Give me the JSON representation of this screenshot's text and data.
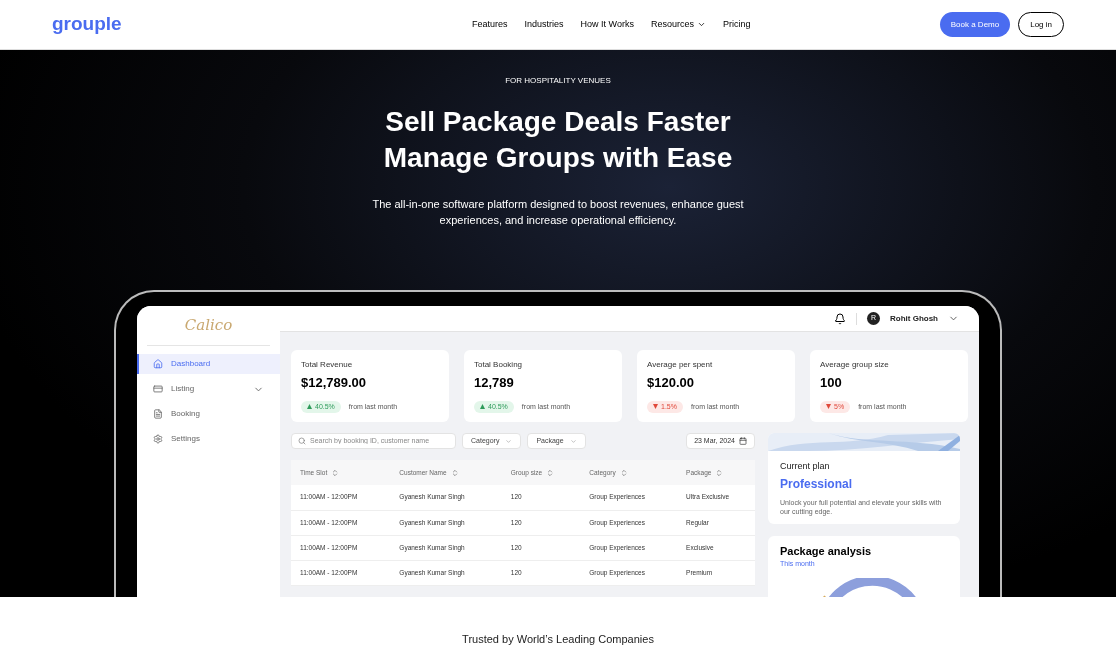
{
  "nav": {
    "logo": "grouple",
    "links": [
      {
        "label": "Features",
        "dropdown": false
      },
      {
        "label": "Industries",
        "dropdown": false
      },
      {
        "label": "How It Works",
        "dropdown": false
      },
      {
        "label": "Resources",
        "dropdown": true
      },
      {
        "label": "Pricing",
        "dropdown": false
      }
    ],
    "demo_button": "Book a Demo",
    "login_button": "Log in"
  },
  "hero": {
    "eyebrow": "FOR HOSPITALITY VENUES",
    "title_lines": [
      "Sell Package Deals Faster",
      "Manage Groups with Ease"
    ],
    "subtitle": "The all-in-one software platform designed to boost revenues, enhance guest experiences, and increase operational efficiency."
  },
  "app": {
    "logo": "Calico",
    "sidebar": [
      {
        "label": "Dashboard",
        "selected": true,
        "expandable": false
      },
      {
        "label": "Listing",
        "selected": false,
        "expandable": true
      },
      {
        "label": "Booking",
        "selected": false,
        "expandable": false
      },
      {
        "label": "Settings",
        "selected": false,
        "expandable": false
      }
    ],
    "user": {
      "initial": "R",
      "name": "Rohit Ghosh"
    },
    "stats": [
      {
        "label": "Total Revenue",
        "value": "$12,789.00",
        "change": "40.5%",
        "kind": "up",
        "note": "from last month"
      },
      {
        "label": "Total Booking",
        "value": "12,789",
        "change": "40.5%",
        "kind": "up",
        "note": "from last month"
      },
      {
        "label": "Average per spent",
        "value": "$120.00",
        "change": "1.5%",
        "kind": "down",
        "note": "from last month"
      },
      {
        "label": "Average group size",
        "value": "100",
        "change": "5%",
        "kind": "down",
        "note": "from last month"
      }
    ],
    "search": {
      "placeholder": "Search by booking ID, customer name"
    },
    "filters": [
      "Category",
      "Package"
    ],
    "date": "23 Mar, 2024",
    "table": {
      "columns": [
        "Time Slot",
        "Customer Name",
        "Group size",
        "Category",
        "Package"
      ],
      "rows": [
        [
          "11:00AM - 12:00PM",
          "Gyanesh Kumar Singh",
          "120",
          "Group Experiences",
          "Ultra Exclusive"
        ],
        [
          "11:00AM - 12:00PM",
          "Gyanesh Kumar Singh",
          "120",
          "Group Experiences",
          "Regular"
        ],
        [
          "11:00AM - 12:00PM",
          "Gyanesh Kumar Singh",
          "120",
          "Group Experiences",
          "Exclusive"
        ],
        [
          "11:00AM - 12:00PM",
          "Gyanesh Kumar Singh",
          "120",
          "Group Experiences",
          "Premium"
        ]
      ]
    },
    "plan": {
      "label": "Current plan",
      "name": "Professional",
      "description": "Unlock your full potential and elevate your skills with our cutting edge."
    },
    "analysis": {
      "title": "Package analysis",
      "period": "This month"
    }
  },
  "trusted": "Trusted by World’s Leading Companies"
}
